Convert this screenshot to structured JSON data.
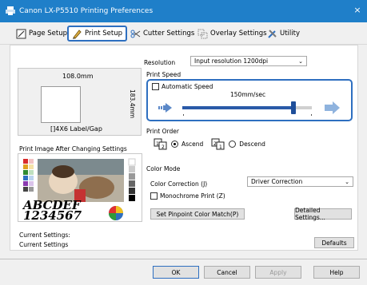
{
  "window": {
    "title": "Canon LX-P5510 Printing Preferences",
    "close": "×"
  },
  "tabs": [
    {
      "label": "Page Setup"
    },
    {
      "label": "Print Setup"
    },
    {
      "label": "Cutter Settings"
    },
    {
      "label": "Overlay Settings"
    },
    {
      "label": "Utility"
    }
  ],
  "preview": {
    "width_label": "108.0mm",
    "height_label": "183.4mm",
    "type_label": "[]4X6 Label/Gap"
  },
  "print_image_caption": "Print Image After Changing Settings",
  "sample_text": {
    "line1": "ABCDEF",
    "line2": "1234567"
  },
  "resolution": {
    "label": "Resolution",
    "value": "Input resolution 1200dpi"
  },
  "print_speed": {
    "group_label": "Print Speed",
    "auto_label": "Automatic Speed",
    "auto_checked": false,
    "value_label": "150mm/sec",
    "level": 0.86
  },
  "print_order": {
    "group_label": "Print Order",
    "ascend": "Ascend",
    "descend": "Descend",
    "selected": "ascend"
  },
  "color_mode": {
    "group_label": "Color Mode",
    "correction_label": "Color Correction (J)",
    "correction_value": "Driver Correction",
    "mono_label": "Monochrome Print (Z)",
    "pinpoint_button": "Set Pinpoint Color Match(P)",
    "details_button": "Detailed Settings..."
  },
  "current_settings": {
    "line1": "Current Settings:",
    "line2": "Current Settings"
  },
  "defaults_button": "Defaults",
  "buttons": {
    "ok": "OK",
    "cancel": "Cancel",
    "apply": "Apply",
    "help": "Help"
  },
  "colors": {
    "titlebar": "#1f7fc9",
    "accent": "#2e6fc0",
    "slider_fill": "#2a5aa8"
  }
}
